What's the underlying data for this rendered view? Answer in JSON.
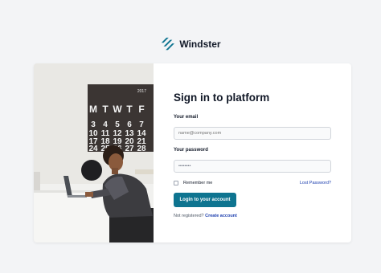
{
  "brand": {
    "name": "Windster",
    "logo_icon": "windster-logo-icon",
    "accent": "#0e7490"
  },
  "login": {
    "title": "Sign in to platform",
    "email_label": "Your email",
    "email_placeholder": "name@company.com",
    "password_label": "Your password",
    "password_value": "••••••••",
    "remember_label": "Remember me",
    "lost_password": "Lost Password?",
    "submit": "Login to your account",
    "not_registered": "Not registered?",
    "create_account": "Create account"
  },
  "calendar": {
    "year": "2017",
    "weekdays": [
      "M",
      "T",
      "W",
      "T",
      "F"
    ],
    "rows": [
      [
        "3",
        "4",
        "5",
        "6",
        "7"
      ],
      [
        "10",
        "11",
        "12",
        "13",
        "14"
      ],
      [
        "17",
        "18",
        "19",
        "20",
        "21"
      ],
      [
        "24",
        "25",
        "26",
        "27",
        "28"
      ]
    ]
  }
}
